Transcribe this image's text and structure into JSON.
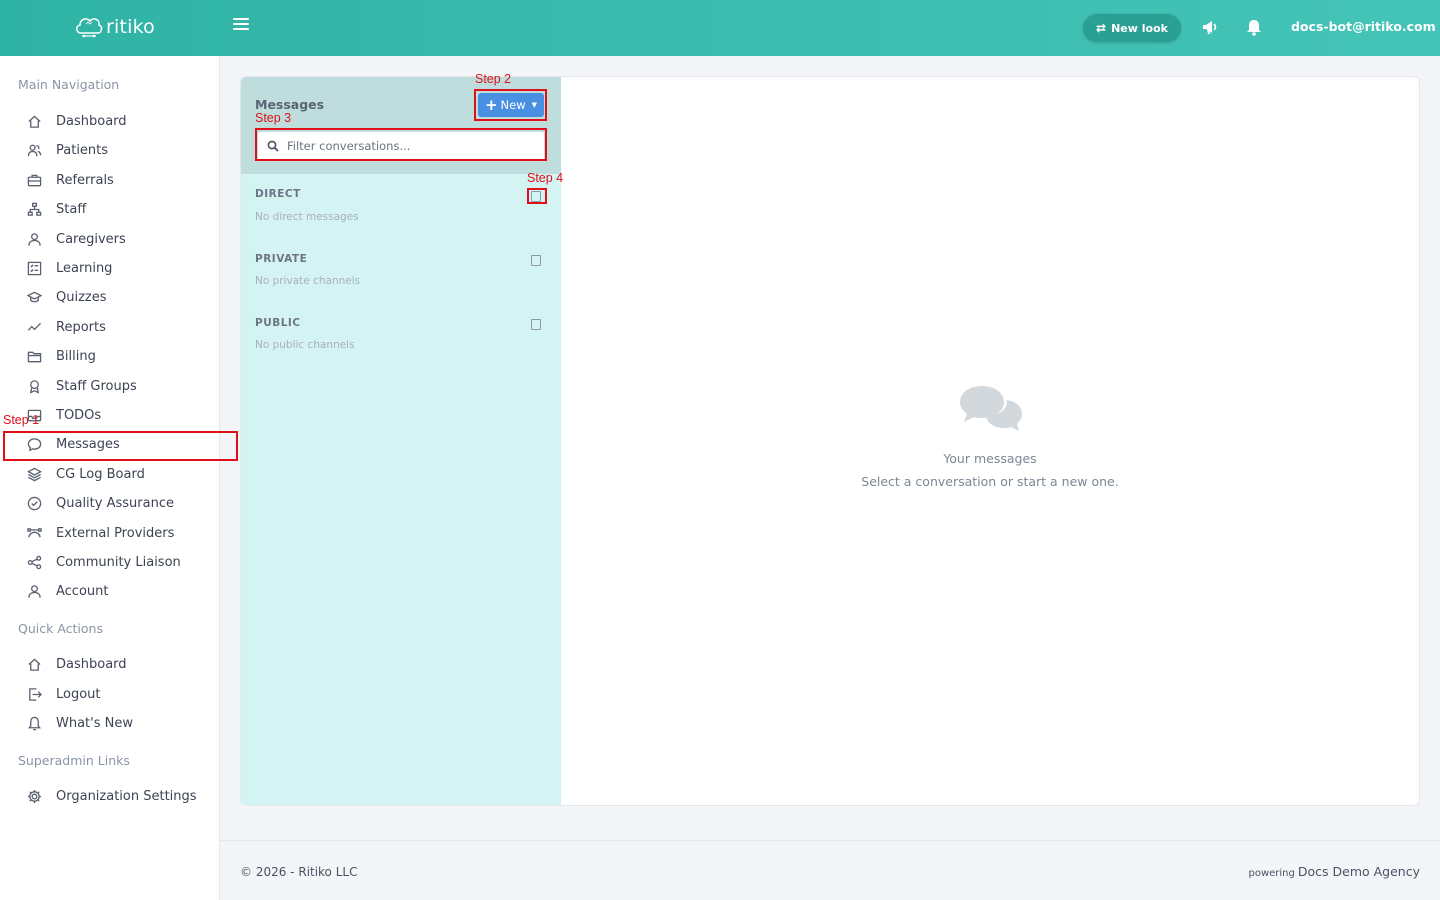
{
  "header": {
    "logo_text": "ritiko",
    "new_look_label": "New look",
    "user_email": "docs-bot@ritiko.com",
    "icons": [
      "hamburger-icon",
      "swap-icon",
      "megaphone-icon",
      "bell-icon"
    ]
  },
  "sidebar": {
    "main_title": "Main Navigation",
    "main_items": [
      {
        "label": "Dashboard",
        "icon": "home-icon"
      },
      {
        "label": "Patients",
        "icon": "users-icon"
      },
      {
        "label": "Referrals",
        "icon": "briefcase-icon"
      },
      {
        "label": "Staff",
        "icon": "org-chart-icon"
      },
      {
        "label": "Caregivers",
        "icon": "user-icon"
      },
      {
        "label": "Learning",
        "icon": "checklist-icon"
      },
      {
        "label": "Quizzes",
        "icon": "graduation-cap-icon"
      },
      {
        "label": "Reports",
        "icon": "trend-line-icon"
      },
      {
        "label": "Billing",
        "icon": "folder-icon"
      },
      {
        "label": "Staff Groups",
        "icon": "award-icon"
      },
      {
        "label": "TODOs",
        "icon": "inbox-icon"
      },
      {
        "label": "Messages",
        "icon": "chat-icon"
      },
      {
        "label": "CG Log Board",
        "icon": "layers-icon"
      },
      {
        "label": "Quality Assurance",
        "icon": "check-circle-icon"
      },
      {
        "label": "External Providers",
        "icon": "bezier-icon"
      },
      {
        "label": "Community Liaison",
        "icon": "share-icon"
      },
      {
        "label": "Account",
        "icon": "user-icon"
      }
    ],
    "quick_title": "Quick Actions",
    "quick_items": [
      {
        "label": "Dashboard",
        "icon": "home-icon"
      },
      {
        "label": "Logout",
        "icon": "logout-icon"
      },
      {
        "label": "What's New",
        "icon": "bell-icon"
      }
    ],
    "super_title": "Superadmin Links",
    "super_items": [
      {
        "label": "Organization Settings",
        "icon": "gear-icon"
      }
    ]
  },
  "messages": {
    "title": "Messages",
    "new_button": "New",
    "filter_placeholder": "Filter conversations...",
    "groups": [
      {
        "label": "DIRECT",
        "empty": "No direct messages"
      },
      {
        "label": "PRIVATE",
        "empty": "No private channels"
      },
      {
        "label": "PUBLIC",
        "empty": "No public channels"
      }
    ],
    "empty_title": "Your messages",
    "empty_subtitle": "Select a conversation or start a new one."
  },
  "footer": {
    "copyright": "© 2026 - Ritiko LLC",
    "powering_small": "powering",
    "agency": "Docs Demo Agency"
  },
  "steps": [
    "Step 1",
    "Step 2",
    "Step 3",
    "Step 4"
  ],
  "colors": {
    "header_start": "#2fb3a5",
    "header_end": "#45c4b8",
    "new_button": "#4a90e2",
    "conv_panel": "#d4f3f3",
    "conv_header": "#bfdddd",
    "annotation": "#e0101a"
  }
}
